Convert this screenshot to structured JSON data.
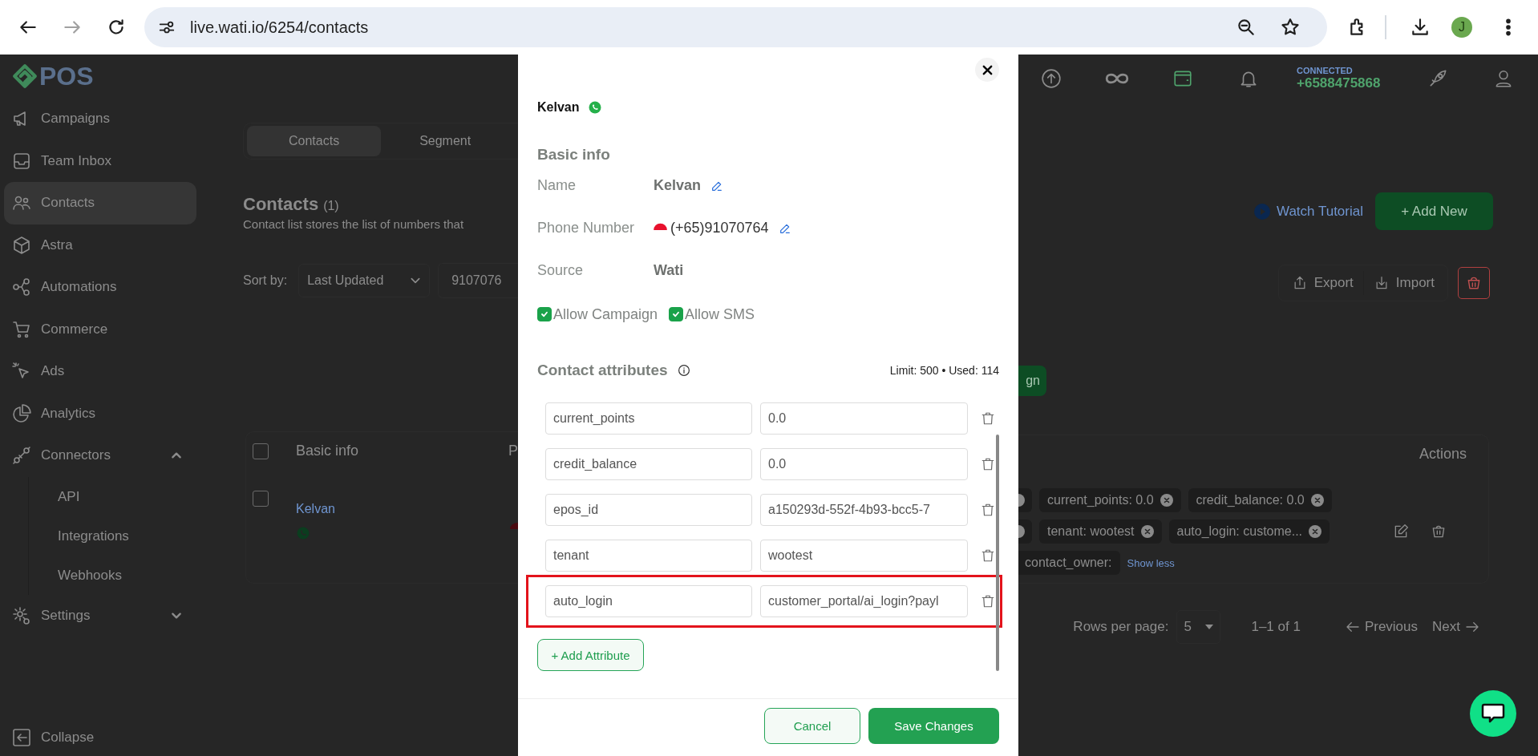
{
  "browser": {
    "url": "live.wati.io/6254/contacts",
    "profile_initial": "J"
  },
  "sidebar": {
    "logo": "POS",
    "items": [
      {
        "label": "Campaigns",
        "selected": false
      },
      {
        "label": "Team Inbox",
        "selected": false
      },
      {
        "label": "Contacts",
        "selected": true
      },
      {
        "label": "Astra",
        "selected": false
      },
      {
        "label": "Automations",
        "selected": false
      },
      {
        "label": "Commerce",
        "selected": false
      },
      {
        "label": "Ads",
        "selected": false
      },
      {
        "label": "Analytics",
        "selected": false
      },
      {
        "label": "Connectors",
        "selected": false,
        "expanded": true,
        "children": [
          {
            "label": "API"
          },
          {
            "label": "Integrations"
          },
          {
            "label": "Webhooks"
          }
        ]
      },
      {
        "label": "Settings",
        "selected": false,
        "expanded": false
      }
    ],
    "collapse": "Collapse"
  },
  "header": {
    "status": "CONNECTED",
    "phone": "+6588475868"
  },
  "tabs": [
    {
      "label": "Contacts",
      "selected": true
    },
    {
      "label": "Segment",
      "selected": false
    }
  ],
  "page": {
    "title": "Contacts",
    "count": "(1)",
    "subtitle": "Contact list stores the list of numbers that",
    "sort_label": "Sort by:",
    "sort_value": "Last Updated",
    "search_value": "9107076",
    "watch_tutorial": "Watch Tutorial",
    "add_new": "+ Add New",
    "export": "Export",
    "import": "Import",
    "campaign_button": "gn"
  },
  "table": {
    "select_all_checked": false,
    "columns": [
      "Basic info",
      "P",
      "Actions"
    ],
    "row": {
      "checked": false,
      "name": "Kelvan",
      "tag_rows": [
        {
          "clipped_chip": true,
          "tags": [
            {
              "text": "current_points: 0.0",
              "removable": true
            },
            {
              "text": "credit_balance: 0.0",
              "removable": true
            }
          ]
        },
        {
          "clipped_chip": true,
          "tags": [
            {
              "text": "tenant: wootest",
              "removable": true
            },
            {
              "text": "auto_login: custome...",
              "removable": true
            }
          ]
        },
        {
          "clipped_chip": false,
          "tags": [
            {
              "text": "contact_owner:",
              "removable": false
            }
          ]
        }
      ],
      "toggle": "Show less"
    }
  },
  "pagination": {
    "rows_label": "Rows per page:",
    "rows_value": "5",
    "range": "1–1 of 1",
    "previous": "Previous",
    "next": "Next"
  },
  "modal": {
    "contact_name": "Kelvan",
    "section_title": "Basic info",
    "fields": [
      {
        "label": "Name",
        "value": "Kelvan",
        "kind": "text",
        "editable": true
      },
      {
        "label": "Phone Number",
        "value": "(+65)91070764",
        "kind": "phone",
        "editable": true
      },
      {
        "label": "Source",
        "value": "Wati",
        "kind": "text",
        "editable": false
      }
    ],
    "consents": [
      {
        "label": "Allow Campaign",
        "checked": true
      },
      {
        "label": "Allow SMS",
        "checked": true
      }
    ],
    "attributes_title": "Contact attributes",
    "usage": "Limit: 500 • Used: 114",
    "attributes": [
      {
        "key": "current_points",
        "value": "0.0",
        "highlighted": false
      },
      {
        "key": "credit_balance",
        "value": "0.0",
        "highlighted": false
      },
      {
        "key": "epos_id",
        "value": "a150293d-552f-4b93-bcc5-7",
        "highlighted": false
      },
      {
        "key": "tenant",
        "value": "wootest",
        "highlighted": false
      },
      {
        "key": "auto_login",
        "value": "customer_portal/ai_login?payl",
        "highlighted": true
      }
    ],
    "add_attribute": "+ Add Attribute",
    "cancel": "Cancel",
    "save": "Save Changes"
  }
}
